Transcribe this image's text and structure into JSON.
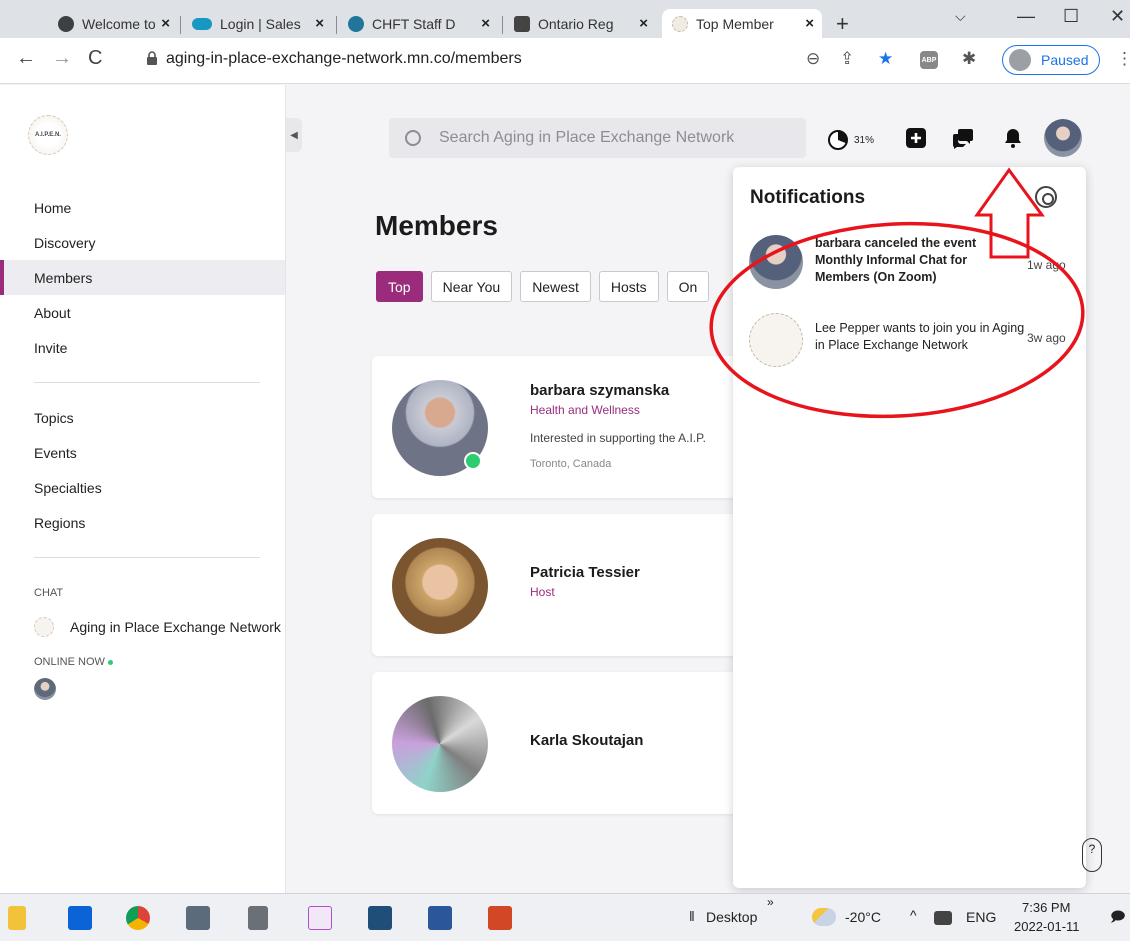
{
  "browser": {
    "tabs": [
      {
        "label": "Welcome to",
        "icon": "globe-icon"
      },
      {
        "label": "Login | Sales",
        "icon": "salesforce-icon"
      },
      {
        "label": "CHFT Staff D",
        "icon": "wordpress-icon"
      },
      {
        "label": "Ontario Reg",
        "icon": "site-icon"
      },
      {
        "label": "Top Member",
        "icon": "network-icon"
      }
    ],
    "url": "aging-in-place-exchange-network.mn.co/members",
    "profile_status": "Paused",
    "abp_label": "ABP"
  },
  "sidebar": {
    "logo_text": "A.I.P.E.N.",
    "nav": [
      {
        "label": "Home"
      },
      {
        "label": "Discovery"
      },
      {
        "label": "Members",
        "active": true
      },
      {
        "label": "About"
      },
      {
        "label": "Invite"
      }
    ],
    "nav2": [
      {
        "label": "Topics"
      },
      {
        "label": "Events"
      },
      {
        "label": "Specialties"
      },
      {
        "label": "Regions"
      }
    ],
    "chat_header": "CHAT",
    "chat_item": "Aging in Place Exchange Network",
    "online_header": "ONLINE NOW"
  },
  "header": {
    "search_placeholder": "Search Aging in Place Exchange Network",
    "progress_label": "31%",
    "progress_value": 0.31
  },
  "main": {
    "title": "Members",
    "filters": [
      "Top",
      "Near You",
      "Newest",
      "Hosts",
      "On"
    ],
    "members": [
      {
        "name": "barbara szymanska",
        "role": "Health and Wellness",
        "bio": "Interested in supporting the A.I.P.",
        "location": "Toronto, Canada",
        "online": true
      },
      {
        "name": "Patricia Tessier",
        "role": "Host"
      },
      {
        "name": "Karla Skoutajan"
      }
    ]
  },
  "notifications": {
    "title": "Notifications",
    "items": [
      {
        "text_bold": "barbara canceled the event Monthly Informal Chat for Members (On Zoom)",
        "time": "1w ago"
      },
      {
        "text": "Lee Pepper wants to join you in Aging in Place Exchange Network",
        "time": "3w ago"
      }
    ]
  },
  "taskbar": {
    "desktop_label": "Desktop",
    "chevron": "»",
    "temperature": "-20°C",
    "language": "ENG",
    "time": "7:36 PM",
    "date": "2022-01-11"
  },
  "colors": {
    "accent": "#9b2c7c",
    "online": "#2ecc71",
    "annotation": "#e8141c"
  }
}
